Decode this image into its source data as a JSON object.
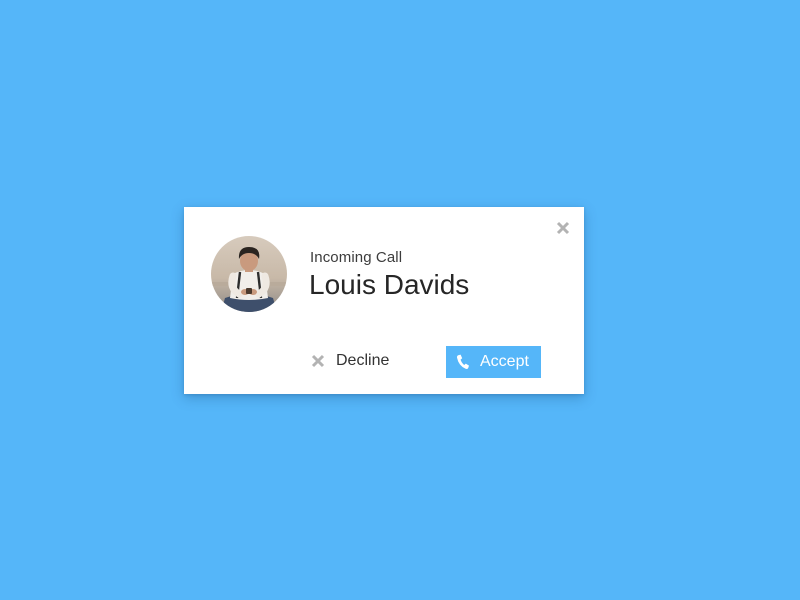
{
  "call": {
    "label": "Incoming Call",
    "caller_name": "Louis Davids"
  },
  "actions": {
    "decline_label": "Decline",
    "accept_label": "Accept"
  },
  "icons": {
    "close": "close-icon",
    "decline": "close-icon",
    "accept": "phone-icon"
  },
  "colors": {
    "background": "#55b6f9",
    "accent": "#55b6f9",
    "card": "#ffffff",
    "icon_gray": "#b3b3b3"
  }
}
